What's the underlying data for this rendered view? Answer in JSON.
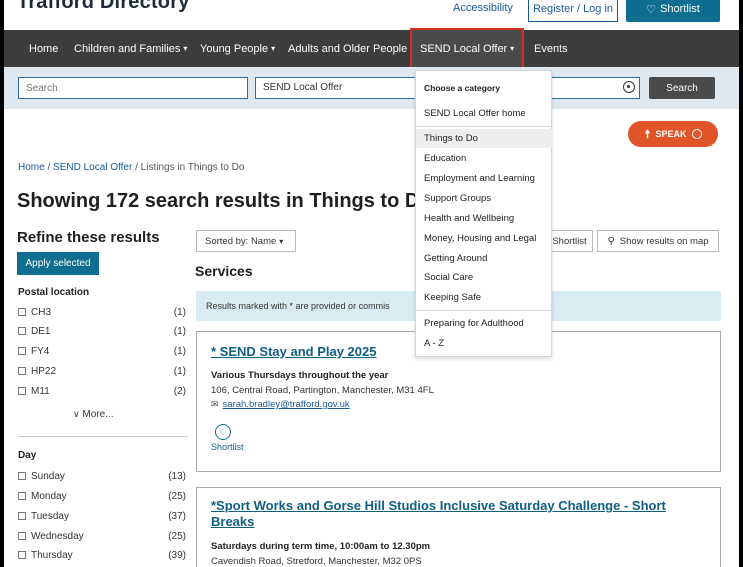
{
  "site": {
    "title": "Trafford Directory",
    "accessibility": "Accessibility",
    "register": "Register / Log in",
    "shortlist": "Shortlist"
  },
  "nav": {
    "items": [
      "Home",
      "Children and Families",
      "Young People",
      "Adults and Older People",
      "SEND Local Offer",
      "Events"
    ]
  },
  "search": {
    "keyword_placeholder": "Search",
    "category_value": "SEND Local Offer",
    "button": "Search"
  },
  "speak": {
    "label": "SPEAK"
  },
  "breadcrumb": {
    "home": "Home",
    "sep1": "/",
    "send": "SEND Local Offer",
    "sep2": "/",
    "current": "Listings in Things to Do"
  },
  "page_heading": "Showing 172 search results in Things to D",
  "sidebar": {
    "refine_title": "Refine these results",
    "apply": "Apply selected",
    "postal_title": "Postal location",
    "postal": [
      {
        "label": "CH3",
        "count": "(1)"
      },
      {
        "label": "DE1",
        "count": "(1)"
      },
      {
        "label": "FY4",
        "count": "(1)"
      },
      {
        "label": "HP22",
        "count": "(1)"
      },
      {
        "label": "M11",
        "count": "(2)"
      }
    ],
    "more": "More...",
    "day_title": "Day",
    "days": [
      {
        "label": "Sunday",
        "count": "(13)"
      },
      {
        "label": "Monday",
        "count": "(25)"
      },
      {
        "label": "Tuesday",
        "count": "(37)"
      },
      {
        "label": "Wednesday",
        "count": "(25)"
      },
      {
        "label": "Thursday",
        "count": "(39)"
      }
    ]
  },
  "results": {
    "sort": "Sorted by: Name",
    "services_title": "Services",
    "shortlist_toggle": "Shortlist",
    "map": "Show results on map",
    "notice": "Results marked with * are provided or commis",
    "cards": [
      {
        "title": "* SEND Stay and Play 2025",
        "schedule": "Various Thursdays throughout the year",
        "address": "106, Central Road, Partington, Manchester, M31 4FL",
        "email": "sarah.bradley@trafford.gov.uk",
        "shortlist": "Shortlist"
      },
      {
        "title": "*Sport Works and Gorse Hill Studios Inclusive Saturday Challenge - Short Breaks",
        "schedule": "Saturdays during term time, 10:00am to 12.30pm",
        "address": "Cavendish Road, Stretford, Manchester, M32 0PS"
      }
    ]
  },
  "dropdown": {
    "heading": "Choose a category",
    "items": [
      "SEND Local Offer home",
      "Things to Do",
      "Education",
      "Employment and Learning",
      "Support Groups",
      "Health and Wellbeing",
      "Money, Housing and Legal",
      "Getting Around",
      "Social Care",
      "Keeping Safe",
      "Preparing for Adulthood",
      "A - Z"
    ]
  }
}
